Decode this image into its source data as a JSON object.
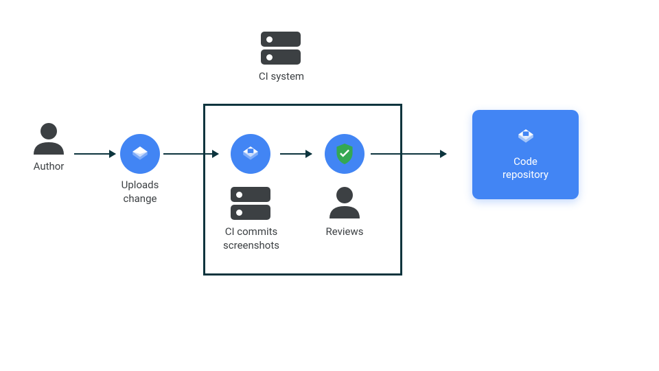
{
  "nodes": {
    "author": {
      "label": "Author"
    },
    "uploads": {
      "label": "Uploads\nchange"
    },
    "ci_system": {
      "label": "CI system"
    },
    "ci_commits": {
      "label": "CI commits\nscreenshots"
    },
    "reviews": {
      "label": "Reviews"
    },
    "repo": {
      "label": "Code\nrepository"
    }
  },
  "colors": {
    "blue": "#4285f4",
    "dark": "#3c4043",
    "border": "#0c343d",
    "green": "#34a853"
  }
}
